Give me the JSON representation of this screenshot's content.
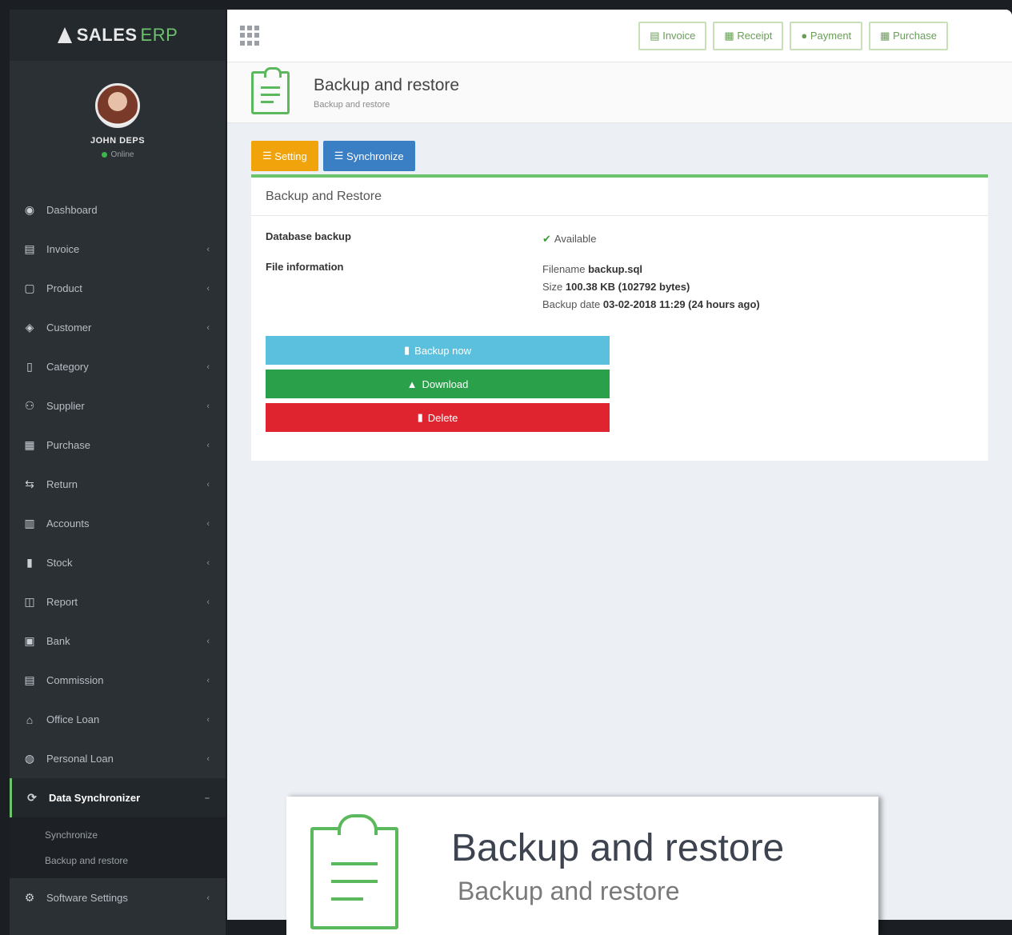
{
  "brand": {
    "name": "SALES",
    "suffix": "ERP"
  },
  "user": {
    "name": "JOHN DEPS",
    "status": "Online"
  },
  "sidebar": {
    "items": [
      {
        "label": "Dashboard",
        "icon": "eye-icon"
      },
      {
        "label": "Invoice",
        "icon": "invoice-icon"
      },
      {
        "label": "Product",
        "icon": "product-icon"
      },
      {
        "label": "Customer",
        "icon": "customer-icon"
      },
      {
        "label": "Category",
        "icon": "category-icon"
      },
      {
        "label": "Supplier",
        "icon": "supplier-icon"
      },
      {
        "label": "Purchase",
        "icon": "purchase-icon"
      },
      {
        "label": "Return",
        "icon": "return-icon"
      },
      {
        "label": "Accounts",
        "icon": "accounts-icon"
      },
      {
        "label": "Stock",
        "icon": "stock-icon"
      },
      {
        "label": "Report",
        "icon": "report-icon"
      },
      {
        "label": "Bank",
        "icon": "bank-icon"
      },
      {
        "label": "Commission",
        "icon": "commission-icon"
      },
      {
        "label": "Office Loan",
        "icon": "office-loan-icon"
      },
      {
        "label": "Personal Loan",
        "icon": "personal-loan-icon"
      }
    ],
    "active": {
      "label": "Data Synchronizer",
      "icon": "sync-icon"
    },
    "sub_items": [
      "Synchronize",
      "Backup and restore"
    ],
    "settings": {
      "label": "Software Settings",
      "icon": "settings-icon"
    }
  },
  "topbar": {
    "buttons": [
      {
        "label": "Invoice",
        "icon": "invoice-icon"
      },
      {
        "label": "Receipt",
        "icon": "receipt-icon"
      },
      {
        "label": "Payment",
        "icon": "payment-icon"
      },
      {
        "label": "Purchase",
        "icon": "purchase-icon"
      }
    ]
  },
  "page": {
    "title": "Backup and restore",
    "subtitle": "Backup and restore"
  },
  "tabs": {
    "setting": "Setting",
    "synchronize": "Synchronize"
  },
  "panel": {
    "heading": "Backup and Restore",
    "database_backup_label": "Database backup",
    "database_backup_value": "Available",
    "file_info_label": "File information",
    "filename_label": "Filename",
    "filename_value": "backup.sql",
    "size_label": "Size",
    "size_value": "100.38 KB (102792 bytes)",
    "backup_date_label": "Backup date",
    "backup_date_value": "03-02-2018 11:29 (24 hours ago)"
  },
  "actions": {
    "backup_now": "Backup now",
    "download": "Download",
    "delete": "Delete"
  },
  "zoom": {
    "title": "Backup and restore",
    "subtitle": "Backup and restore"
  }
}
